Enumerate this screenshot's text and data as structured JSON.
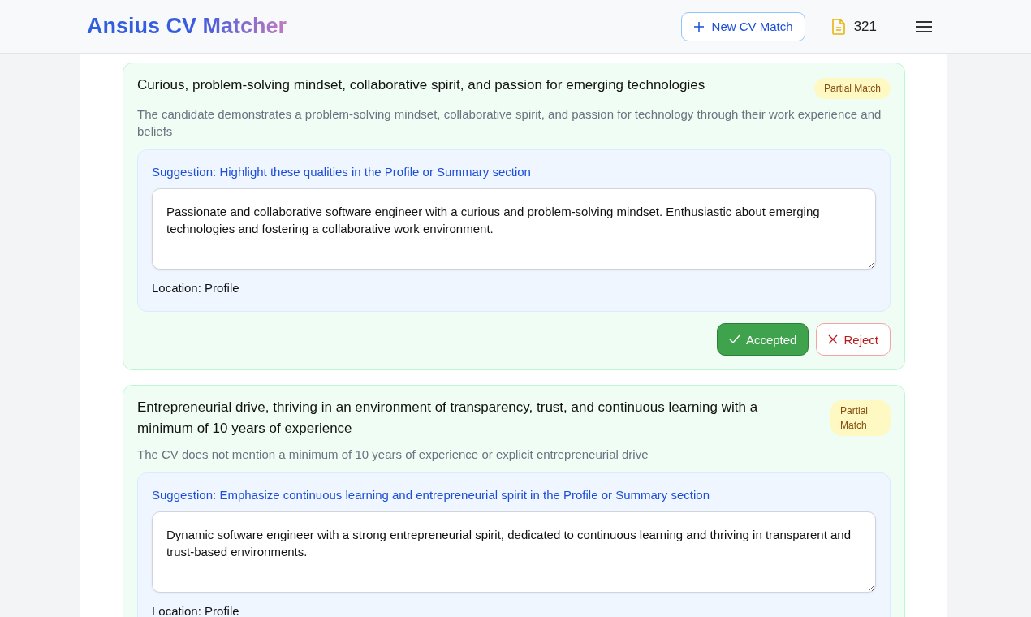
{
  "header": {
    "logo": "Ansius CV Matcher",
    "new_button": "New CV Match",
    "credits": "321"
  },
  "matches": [
    {
      "requirement": "Curious, problem-solving mindset, collaborative spirit, and passion for emerging technologies",
      "badge": "Partial Match",
      "explanation": "The candidate demonstrates a problem-solving mindset, collaborative spirit, and passion for technology through their work experience and beliefs",
      "suggestion": "Suggestion: Highlight these qualities in the Profile or Summary section",
      "text": "Passionate and collaborative software engineer with a curious and problem-solving mindset. Enthusiastic about emerging technologies and fostering a collaborative work environment.",
      "location": "Location: Profile",
      "actions": {
        "accept": "Accepted",
        "reject": "Reject",
        "accepted": true
      }
    },
    {
      "requirement": "Entrepreneurial drive, thriving in an environment of transparency, trust, and continuous learning with a minimum of 10 years of experience",
      "badge": "Partial Match",
      "explanation": "The CV does not mention a minimum of 10 years of experience or explicit entrepreneurial drive",
      "suggestion": "Suggestion: Emphasize continuous learning and entrepreneurial spirit in the Profile or Summary section",
      "text": "Dynamic software engineer with a strong entrepreneurial spirit, dedicated to continuous learning and thriving in transparent and trust-based environments.",
      "location": "Location: Profile"
    }
  ]
}
